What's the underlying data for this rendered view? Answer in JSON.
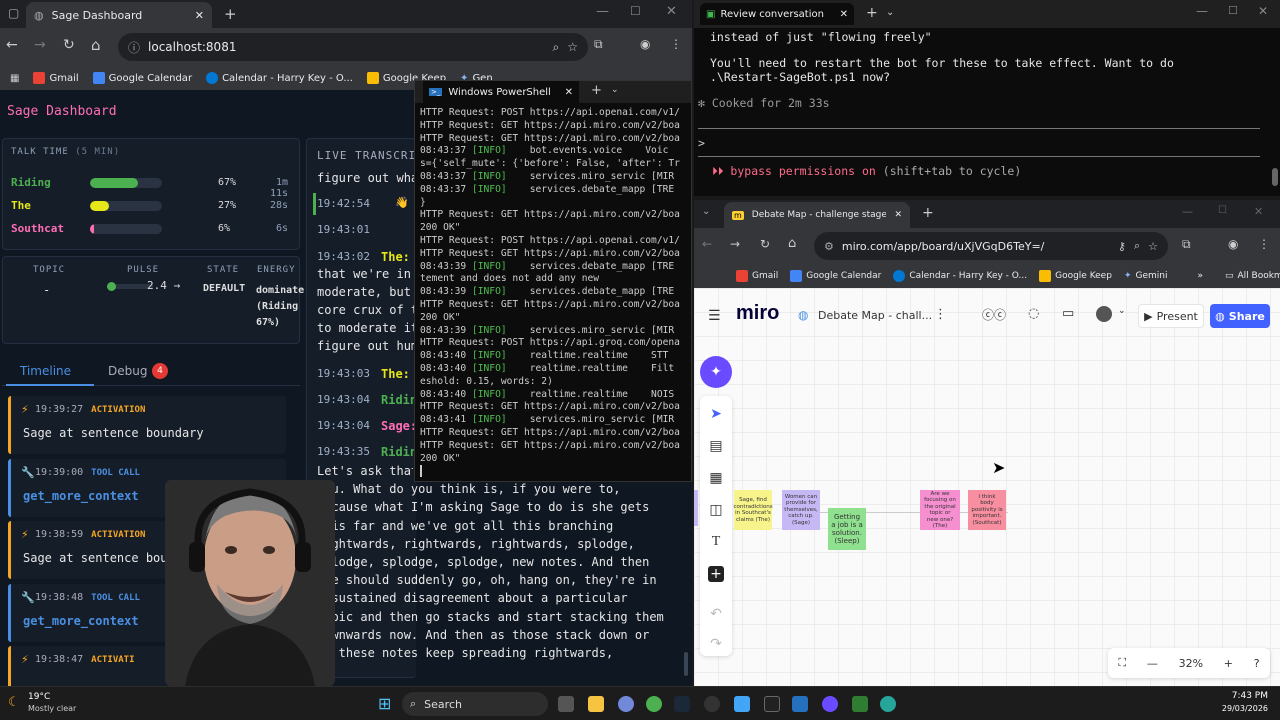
{
  "left_browser": {
    "tab_title": "Sage Dashboard",
    "url": "localhost:8081",
    "bookmarks": [
      "Gmail",
      "Google Calendar",
      "Calendar - Harry Key - O...",
      "Google Keep",
      "Gen"
    ]
  },
  "dashboard": {
    "title": "Sage Dashboard",
    "talk_time": {
      "label": "TALK TIME",
      "window": "(5 MIN)",
      "speakers": [
        {
          "name": "Riding",
          "pct": "67%",
          "fraction": 0.67,
          "time": "1m 11s",
          "color": "#4caf50"
        },
        {
          "name": "The",
          "pct": "27%",
          "fraction": 0.27,
          "time": "28s",
          "color": "#e6e619"
        },
        {
          "name": "Southcat",
          "pct": "6%",
          "fraction": 0.06,
          "time": "6s",
          "color": "#ff6eb5"
        }
      ]
    },
    "stats": {
      "topic_label": "TOPIC",
      "topic_value": "-",
      "pulse_label": "PULSE",
      "pulse_value": "2.4 →",
      "state_label": "STATE",
      "state_value": "DEFAULT",
      "energy_label": "ENERGY",
      "energy_value": "dominate (Riding 67%)"
    },
    "tabs": {
      "timeline": "Timeline",
      "debug": "Debug",
      "debug_count": "4"
    },
    "events": [
      {
        "time": "19:39:27",
        "kind": "ACTIVATION",
        "text": "Sage at sentence boundary",
        "color": "#f5a623"
      },
      {
        "time": "19:39:00",
        "kind": "TOOL CALL",
        "text": "get_more_context",
        "color": "#4a90e2"
      },
      {
        "time": "19:38:59",
        "kind": "ACTIVATION",
        "text": "Sage at sentence bound",
        "color": "#f5a623"
      },
      {
        "time": "19:38:48",
        "kind": "TOOL CALL",
        "text": "get_more_context",
        "color": "#4a90e2"
      },
      {
        "time": "19:38:47",
        "kind": "ACTIVATI",
        "text": "",
        "color": "#f5a623"
      }
    ],
    "transcript": {
      "header": "LIVE TRANSCRIP",
      "first_line": "figure out wha",
      "rows": [
        {
          "time": "19:42:54",
          "speaker": "",
          "text": ""
        },
        {
          "time": "19:43:01",
          "speaker": "",
          "text": ""
        },
        {
          "time": "19:43:02",
          "speaker": "The:",
          "text": ""
        },
        {
          "time": "19:43:03",
          "speaker": "The:",
          "text": ""
        },
        {
          "time": "19:43:04",
          "speaker": "Ridin",
          "text": ""
        },
        {
          "time": "19:43:04",
          "speaker": "Sage:",
          "text": ""
        },
        {
          "time": "19:43:35",
          "speaker": "Ridin",
          "text": ""
        }
      ],
      "block_a": [
        "that we're in",
        "moderate, but",
        "core crux of t",
        "to moderate it",
        "figure out hum"
      ],
      "long_text": [
        "Let's ask that",
        "you. What do you think is, if you were to,",
        "because what I'm asking Sage to do is she gets",
        "this far and we've got all this branching",
        "rightwards, rightwards, rightwards, splodge,",
        "splodge, splodge, splodge, new notes. And then",
        "she should suddenly go, oh, hang on, they're in",
        "a sustained disagreement about a particular",
        "topic and then go stacks and start stacking them",
        "downwards now. And then as those stack down or",
        "as these notes keep spreading rightwards,"
      ]
    }
  },
  "powershell": {
    "title": "Windows PowerShell",
    "lines": [
      "HTTP Request: POST https://api.openai.com/v1/",
      "HTTP Request: GET https://api.miro.com/v2/boa",
      "HTTP Request: GET https://api.miro.com/v2/boa",
      "08:43:37 [INFO]    bot.events.voice    Voic",
      "s={'self_mute': {'before': False, 'after': Tr",
      "08:43:37 [INFO]    services.miro_servic [MIR",
      "08:43:37 [INFO]    services.debate_mapp [TRE",
      "}",
      "HTTP Request: GET https://api.miro.com/v2/boa",
      "200 OK\"",
      "HTTP Request: POST https://api.openai.com/v1/",
      "HTTP Request: GET https://api.miro.com/v2/boa",
      "08:43:39 [INFO]    services.debate_mapp [TRE",
      "tement and does not add any new",
      "08:43:39 [INFO]    services.debate_mapp [TRE",
      "HTTP Request: GET https://api.miro.com/v2/boa",
      "200 OK\"",
      "08:43:39 [INFO]    services.miro_servic [MIR",
      "HTTP Request: POST https://api.groq.com/opena",
      "08:43:40 [INFO]    realtime.realtime    STT",
      "08:43:40 [INFO]    realtime.realtime    Filt",
      "eshold: 0.15, words: 2)",
      "08:43:40 [INFO]    realtime.realtime    NOIS",
      "HTTP Request: GET https://api.miro.com/v2/boa",
      "08:43:41 [INFO]    services.miro_servic [MIR",
      "HTTP Request: GET https://api.miro.com/v2/boa",
      "HTTP Request: GET https://api.miro.com/v2/boa",
      "200 OK\""
    ]
  },
  "terminal": {
    "tab_title": "Review conversation",
    "line1": "instead of just \"flowing freely\"",
    "line2": "You'll need to restart the bot for these to take effect. Want to do",
    "line3": ".\\Restart-SageBot.ps1 now?",
    "cooked": "✻ Cooked for 2m 33s",
    "prompt": ">",
    "bypass_a": "⏵⏵ bypass permissions on",
    "bypass_b": "(shift+tab to cycle)"
  },
  "miro_browser": {
    "tab_title": "Debate Map - challenge stage - Miro",
    "url": "miro.com/app/board/uXjVGqD6TeY=/",
    "bookmarks": [
      "Gmail",
      "Google Calendar",
      "Calendar - Harry Key - O...",
      "Google Keep",
      "Gemini",
      "All Bookmarks"
    ],
    "logo": "miro",
    "board_name": "Debate Map - chall...",
    "present": "Present",
    "share": "Share",
    "zoom": "32%",
    "stickies": [
      {
        "text": "Sage, find contradictions in Southcat's claims (The)",
        "color": "#f7f48b"
      },
      {
        "text": "Women can provide for themselves, catch up. (Sage)",
        "color": "#c6b8f5"
      },
      {
        "text": "Getting a job is a solution. (Sleep)",
        "color": "#8fe08f"
      },
      {
        "text": "Are we focusing on the original topic or new one? (The)",
        "color": "#f58fd0"
      },
      {
        "text": "I think body positivity is important. (Southcat)",
        "color": "#f78fa0"
      }
    ]
  },
  "taskbar": {
    "weather_temp": "19°C",
    "weather_desc": "Mostly clear",
    "search": "Search",
    "time": "7:43 PM",
    "date": "29/03/2026"
  }
}
